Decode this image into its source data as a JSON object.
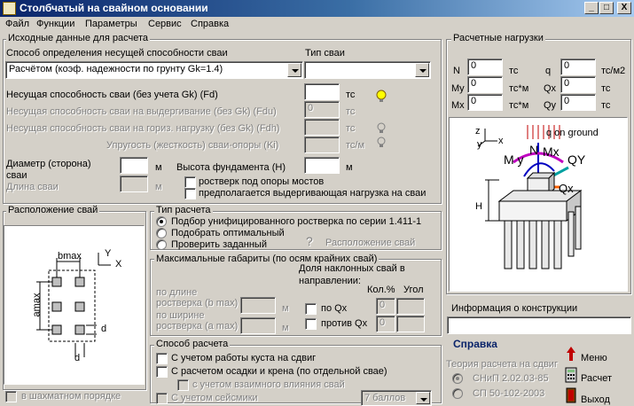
{
  "window": {
    "title": "Столбчатый на свайном основании",
    "min_label": "_",
    "max_label": "□",
    "close_label": "X"
  },
  "menu": [
    "Файл",
    "Функции",
    "Параметры",
    "Сервис",
    "Справка"
  ],
  "source": {
    "group_title": "Исходные данные для расчета",
    "method_label": "Способ определения несущей способности сваи",
    "method_value": "Расчётом  (коэф. надежности по грунту Gk=1.4)",
    "pile_type_label": "Тип сваи",
    "pile_type_value": "",
    "fd_label": "Несущая способность сваи (без учета Gk)  (Fd)",
    "fd_value": "",
    "fd_unit": "тс",
    "fdu_label": "Несущая способность сваи на выдергивание (без Gk)  (Fdu)",
    "fdu_value": "0",
    "fdu_unit": "тс",
    "fdh_label": "Несущая способность сваи на гориз. нагрузку (без Gk)  (Fdh)",
    "fdh_value": "",
    "fdh_unit": "тс",
    "ki_label": "Упругость (жесткость) сваи-опоры (Ki)",
    "ki_value": "",
    "ki_unit": "тс/м",
    "diam_label_1": "Диаметр (сторона)",
    "diam_label_2": "сваи",
    "diam_value": "",
    "diam_unit": "м",
    "length_label": "Длина сваи",
    "length_value": "",
    "length_unit": "м",
    "height_label": "Высота фундамента (H)",
    "height_value": "",
    "height_unit": "м",
    "bridge_label": "ростверк под опоры мостов",
    "pullout_label": "предполагается выдергивающая нагрузка на сваи"
  },
  "loads": {
    "group_title": "Расчетные нагрузки",
    "N_label": "N",
    "N_value": "0",
    "N_unit": "тс",
    "My_label": "My",
    "My_value": "0",
    "My_unit": "тс*м",
    "Mx_label": "Mx",
    "Mx_value": "0",
    "Mx_unit": "тс*м",
    "q_label": "q",
    "q_value": "0",
    "q_unit": "тс/м2",
    "Qx_label": "Qx",
    "Qx_value": "0",
    "Qx_unit": "тс",
    "Qy_label": "Qy",
    "Qy_value": "0",
    "Qy_unit": "тс",
    "fig_q_on_ground": "q on ground",
    "fig_N": "N",
    "fig_My": "M y",
    "fig_Mx": "Mx",
    "fig_Qy": "QY",
    "fig_Qx": "Qx",
    "fig_H": "H",
    "fig_z": "z",
    "fig_x": "x",
    "fig_y": "y"
  },
  "layout": {
    "group_title": "Расположение свай",
    "bmax": "bmax",
    "amax": "amax",
    "d1": "d",
    "d2": "d",
    "y": "Y",
    "x": "X",
    "staggered_label": "в шахматном порядке"
  },
  "calc_type": {
    "group_title": "Тип расчета",
    "opt1": "Подбор унифицированного ростверка по серии 1.411-1",
    "opt2": "Подобрать оптимальный",
    "opt3": "Проверить заданный",
    "help_mark": "?",
    "arrangement_label": "Расположение свай"
  },
  "dims": {
    "group_title": "Максимальные габариты (по осям крайних свай)",
    "incline_1": "Доля наклонных свай в",
    "incline_2": "направлении:",
    "col_count": "Кол.%",
    "col_angle": "Угол",
    "len_1": "по длине",
    "len_2": "ростверка (b max)",
    "len_unit": "м",
    "wid_1": "по ширине",
    "wid_2": "ростверка (a max)",
    "wid_unit": "м",
    "along_qx": "по Qx",
    "along_qx_value": "0",
    "against_qx": "против Qx",
    "against_qx_value": "0"
  },
  "method": {
    "group_title": "Способ расчета",
    "opt1": "С учетом работы куста на сдвиг",
    "opt2": "С расчетом осадки и крена (по отдельной свае)",
    "opt3": "с учетом взаимного влияния свай",
    "opt4": "С учетом сейсмики",
    "seismic_value": "7 баллов"
  },
  "info": {
    "group_title": "Информация о конструкции",
    "value": ""
  },
  "help": {
    "title": "Справка",
    "theory": "Теория расчета на сдвиг",
    "snip": "СНиП 2.02.03-85",
    "sp": "СП 50-102-2003"
  },
  "buttons": {
    "menu": "Меню",
    "calc": "Расчет",
    "exit": "Выход"
  }
}
